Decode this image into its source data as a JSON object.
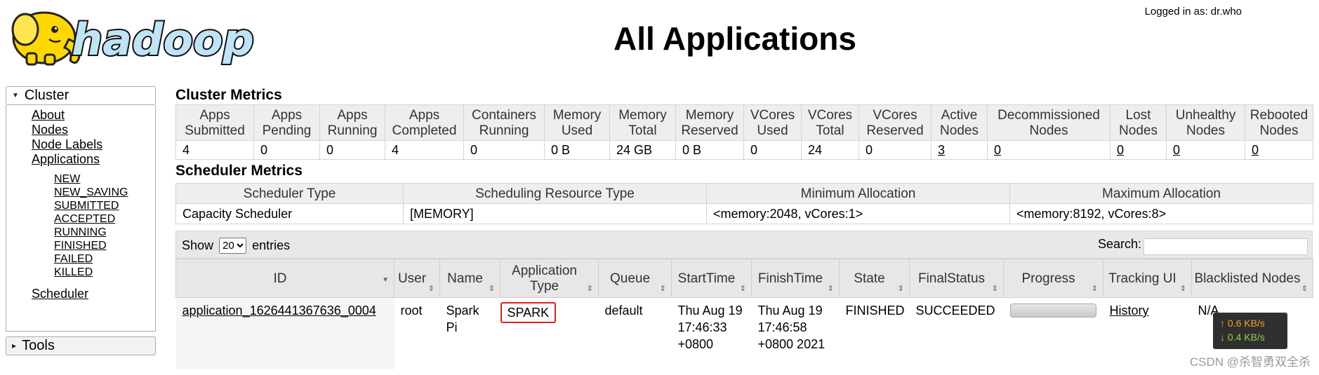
{
  "header": {
    "logo_text": "hadoop",
    "page_title": "All Applications",
    "logged_in": "Logged in as: dr.who"
  },
  "sidebar": {
    "cluster_label": "Cluster",
    "links": [
      "About",
      "Nodes",
      "Node Labels",
      "Applications"
    ],
    "app_states": [
      "NEW",
      "NEW_SAVING",
      "SUBMITTED",
      "ACCEPTED",
      "RUNNING",
      "FINISHED",
      "FAILED",
      "KILLED"
    ],
    "scheduler": "Scheduler",
    "tools_label": "Tools"
  },
  "cluster_metrics": {
    "title": "Cluster Metrics",
    "headers": [
      "Apps Submitted",
      "Apps Pending",
      "Apps Running",
      "Apps Completed",
      "Containers Running",
      "Memory Used",
      "Memory Total",
      "Memory Reserved",
      "VCores Used",
      "VCores Total",
      "VCores Reserved",
      "Active Nodes",
      "Decommissioned Nodes",
      "Lost Nodes",
      "Unhealthy Nodes",
      "Rebooted Nodes"
    ],
    "values": [
      "4",
      "0",
      "0",
      "4",
      "0",
      "0 B",
      "24 GB",
      "0 B",
      "0",
      "24",
      "0",
      "3",
      "0",
      "0",
      "0",
      "0"
    ]
  },
  "scheduler_metrics": {
    "title": "Scheduler Metrics",
    "headers": [
      "Scheduler Type",
      "Scheduling Resource Type",
      "Minimum Allocation",
      "Maximum Allocation"
    ],
    "values": [
      "Capacity Scheduler",
      "[MEMORY]",
      "<memory:2048, vCores:1>",
      "<memory:8192, vCores:8>"
    ]
  },
  "table_controls": {
    "show": "Show",
    "entries_value": "20",
    "entries": "entries",
    "search": "Search:"
  },
  "apps": {
    "headers": [
      "ID",
      "User",
      "Name",
      "Application Type",
      "Queue",
      "StartTime",
      "FinishTime",
      "State",
      "FinalStatus",
      "Progress",
      "Tracking UI",
      "Blacklisted Nodes"
    ],
    "row": {
      "id": "application_1626441367636_0004",
      "user": "root",
      "name": "Spark Pi",
      "type": "SPARK",
      "queue": "default",
      "start": "Thu Aug 19 17:46:33 +0800",
      "finish": "Thu Aug 19 17:46:58 +0800 2021",
      "state": "FINISHED",
      "final_status": "SUCCEEDED",
      "progress": 1.0,
      "tracking": "History",
      "blacklisted": "N/A"
    }
  },
  "net_widget": {
    "up": "↑ 0.6 KB/s",
    "down": "↓ 0.4 KB/s"
  },
  "watermark": "CSDN @杀智勇双全杀",
  "colors": {
    "highlight_box": "#e0201c",
    "elephant": "#ffd800",
    "logo_text": "#1a3e9a"
  }
}
